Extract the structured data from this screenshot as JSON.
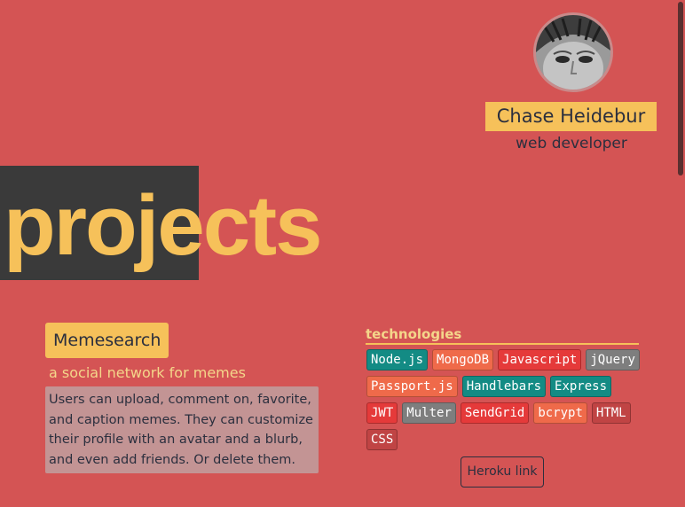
{
  "profile": {
    "name": "Chase Heidebur",
    "role": "web developer"
  },
  "page": {
    "title_highlight": "proj",
    "title_rest": "ects"
  },
  "project": {
    "name": "Memesearch",
    "tagline": "a social network for memes",
    "description": "Users can upload, comment on, favorite, and caption memes. They can customize their profile with an avatar and a blurb, and even add friends. Or delete them.",
    "technologies_heading": "technologies",
    "technologies": [
      {
        "label": "Node.js",
        "color": "#138b84"
      },
      {
        "label": "MongoDB",
        "color": "#ef6a4a"
      },
      {
        "label": "Javascript",
        "color": "#e53a3a"
      },
      {
        "label": "jQuery",
        "color": "#7e7e7e"
      },
      {
        "label": "Passport.js",
        "color": "#ef6a4a"
      },
      {
        "label": "Handlebars",
        "color": "#138b84"
      },
      {
        "label": "Express",
        "color": "#138b84"
      },
      {
        "label": "JWT",
        "color": "#e53a3a"
      },
      {
        "label": "Multer",
        "color": "#7e7e7e"
      },
      {
        "label": "SendGrid",
        "color": "#e53a3a"
      },
      {
        "label": "bcrypt",
        "color": "#ef6a4a"
      },
      {
        "label": "HTML",
        "color": "#c04444"
      },
      {
        "label": "CSS",
        "color": "#c04444"
      }
    ],
    "link_label": "Heroku link"
  },
  "colors": {
    "background": "#d45454",
    "accent": "#f6c15a",
    "dark": "#3a3a3a"
  }
}
